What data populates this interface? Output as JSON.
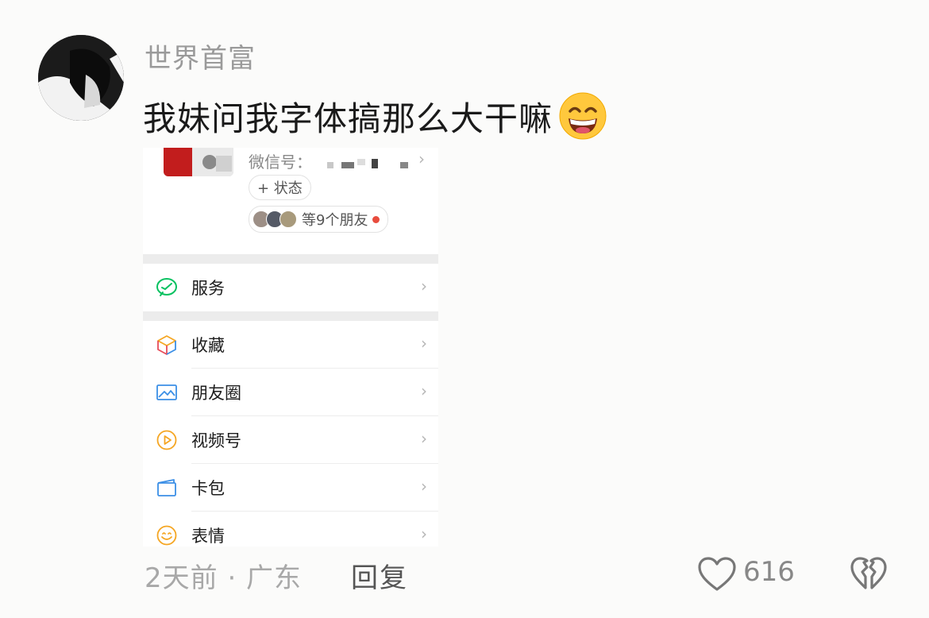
{
  "comment": {
    "username": "世界首富",
    "text": "我妹问我字体搞那么大干嘛",
    "time_location": "2天前 · 广东",
    "reply_label": "回复",
    "like_count": "616"
  },
  "embedded_screenshot": {
    "wechat_id_label": "微信号：",
    "status_button": "+ 状态",
    "friends_text": "等9个朋友",
    "menu": [
      {
        "label": "服务",
        "icon": "wechat-pay-icon"
      },
      {
        "label": "收藏",
        "icon": "favorites-cube-icon"
      },
      {
        "label": "朋友圈",
        "icon": "moments-picture-icon"
      },
      {
        "label": "视频号",
        "icon": "channels-play-icon"
      },
      {
        "label": "卡包",
        "icon": "card-wallet-icon"
      },
      {
        "label": "表情",
        "icon": "sticker-smile-icon"
      }
    ]
  },
  "colors": {
    "accent_green": "#07c160",
    "dot_red": "#e84c3d"
  }
}
